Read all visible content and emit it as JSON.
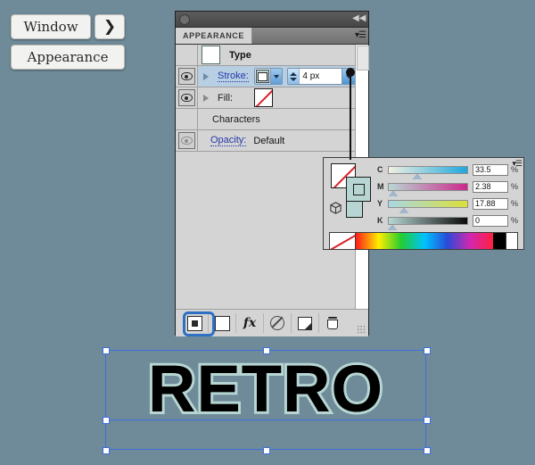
{
  "callouts": {
    "window_label": "Window",
    "arrow_glyph": "❯",
    "appearance_label": "Appearance"
  },
  "appearance_panel": {
    "tab_label": "APPEARANCE",
    "collapse_glyph": "◀◀",
    "menu_glyph": "▾☰",
    "rows": [
      {
        "name": "type",
        "label": "Type",
        "has_eye": false,
        "swatch": "white"
      },
      {
        "name": "stroke",
        "label": "Stroke:",
        "has_eye": true,
        "selected": true,
        "stroke_color": "#b7d6d3",
        "width_value": "4 px"
      },
      {
        "name": "fill",
        "label": "Fill:",
        "has_eye": true,
        "fill": "none"
      },
      {
        "name": "characters",
        "label": "Characters",
        "has_eye": false
      },
      {
        "name": "opacity",
        "label": "Opacity:",
        "has_eye": true,
        "value": "Default"
      }
    ],
    "toolbar": [
      {
        "name": "add-new-stroke-button",
        "icon": "filled-square-icon",
        "selected": true
      },
      {
        "name": "add-new-fill-button",
        "icon": "empty-square-icon",
        "selected": false
      },
      {
        "name": "add-new-effect-button",
        "icon": "fx-icon",
        "label": "fx",
        "selected": false
      },
      {
        "name": "clear-appearance-button",
        "icon": "no-symbol-icon",
        "selected": false
      },
      {
        "name": "duplicate-item-button",
        "icon": "duplicate-icon",
        "selected": false
      },
      {
        "name": "delete-item-button",
        "icon": "trash-icon",
        "selected": false
      }
    ]
  },
  "color_panel": {
    "menu_glyph": "▾☰",
    "fill_swatch": "none",
    "stroke_swatch": "#b7d6d3",
    "channels": [
      {
        "name": "cyan",
        "label": "C",
        "value": "33.5",
        "unit": "%",
        "pos": 33.5
      },
      {
        "name": "magenta",
        "label": "M",
        "value": "2.38",
        "unit": "%",
        "pos": 2.38
      },
      {
        "name": "yellow",
        "label": "Y",
        "value": "17.88",
        "unit": "%",
        "pos": 17.88
      },
      {
        "name": "black",
        "label": "K",
        "value": "0",
        "unit": "%",
        "pos": 0
      }
    ]
  },
  "artwork": {
    "text": "RETRO",
    "fill_color": "#000000",
    "stroke_color": "#b7d6d3",
    "selection_color": "#3e6ee0"
  },
  "canvas": {
    "background": "#6f8b99"
  }
}
